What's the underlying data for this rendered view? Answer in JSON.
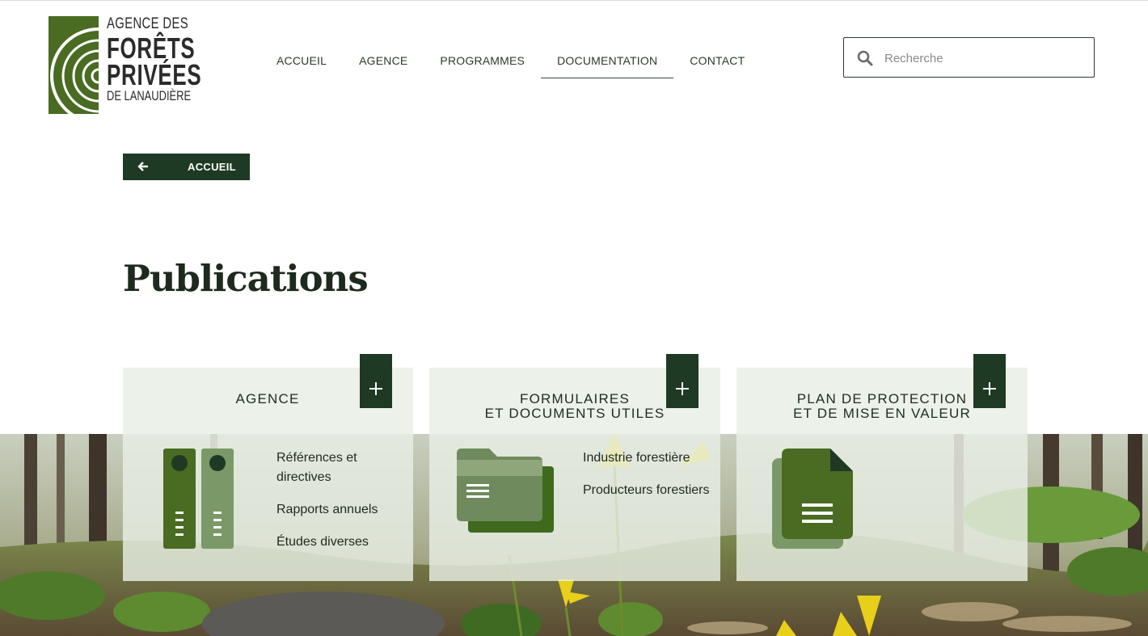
{
  "logo": {
    "line1": "AGENCE DES",
    "line2": "FORÊTS",
    "line3": "PRIVÉES",
    "line4": "DE LANAUDIÈRE"
  },
  "nav": {
    "items": [
      "ACCUEIL",
      "AGENCE",
      "PROGRAMMES",
      "DOCUMENTATION",
      "CONTACT"
    ],
    "active": "DOCUMENTATION"
  },
  "search": {
    "placeholder": "Recherche"
  },
  "back_button": {
    "label": "ACCUEIL"
  },
  "page_title": "Publications",
  "cards": [
    {
      "title_line1": "AGENCE",
      "title_line2": "",
      "links": [
        "Références et directives",
        "Rapports annuels",
        "Études diverses"
      ]
    },
    {
      "title_line1": "FORMULAIRES",
      "title_line2": "ET DOCUMENTS UTILES",
      "links": [
        "Industrie forestière",
        "Producteurs forestiers"
      ]
    },
    {
      "title_line1": "PLAN DE PROTECTION",
      "title_line2": "ET DE MISE EN VALEUR",
      "links": []
    }
  ],
  "colors": {
    "brand_dark": "#1e3a24",
    "brand_green": "#4a6b22",
    "card_bg": "#e8eee4"
  },
  "icons": [
    "search-icon",
    "arrow-left-icon",
    "plus-icon",
    "binders-icon",
    "folder-icon",
    "document-icon"
  ]
}
